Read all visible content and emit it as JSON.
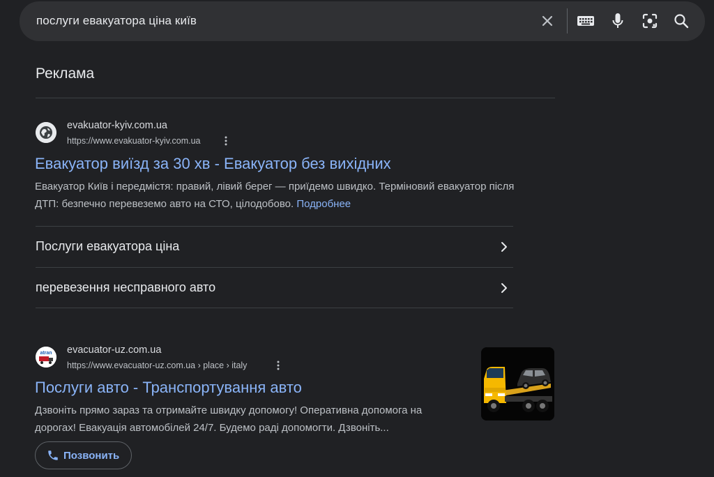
{
  "search": {
    "query": "послуги евакуатора ціна київ",
    "icons": [
      "close-icon",
      "keyboard-icon",
      "microphone-icon",
      "lens-icon",
      "search-icon"
    ]
  },
  "ads_label": "Реклама",
  "ads": [
    {
      "site_name": "evakuator-kyiv.com.ua",
      "url": "https://www.evakuator-kyiv.com.ua",
      "favicon": "globe-icon",
      "title": "Евакуатор виїзд за 30 хв - Евакуатор без вихідних",
      "description_line1": "Евакуатор Київ і передмістя: правий, лівий берег — приїдемо швидко. Терміновий евакуатор після",
      "description_line2": "ДТП: безпечно перевеземо авто на СТО, цілодобово.",
      "more_link": "Подробнее",
      "sitelinks": [
        {
          "label": "Послуги евакуатора ціна"
        },
        {
          "label": "перевезення несправного авто"
        }
      ]
    },
    {
      "site_name": "evacuator-uz.com.ua",
      "url": "https://www.evacuator-uz.com.ua › place › italy",
      "favicon": "tow-truck-logo",
      "favicon_text": "atran",
      "title": "Послуги авто - Транспортування авто",
      "description_line1": "Дзвоніть прямо зараз та отримайте швидку допомогу! Оперативна допомога на",
      "description_line2": "дорогах! Евакуація автомобілей 24/7. Будемо раді допомогти. Дзвоніть...",
      "call_button": "Позвонить",
      "thumbnail": "tow-truck-image"
    }
  ],
  "colors": {
    "background": "#202124",
    "search_bar": "#303134",
    "link": "#8ab4f8",
    "text": "#e8eaed",
    "secondary_text": "#bdc1c6",
    "divider": "#3c4043"
  }
}
